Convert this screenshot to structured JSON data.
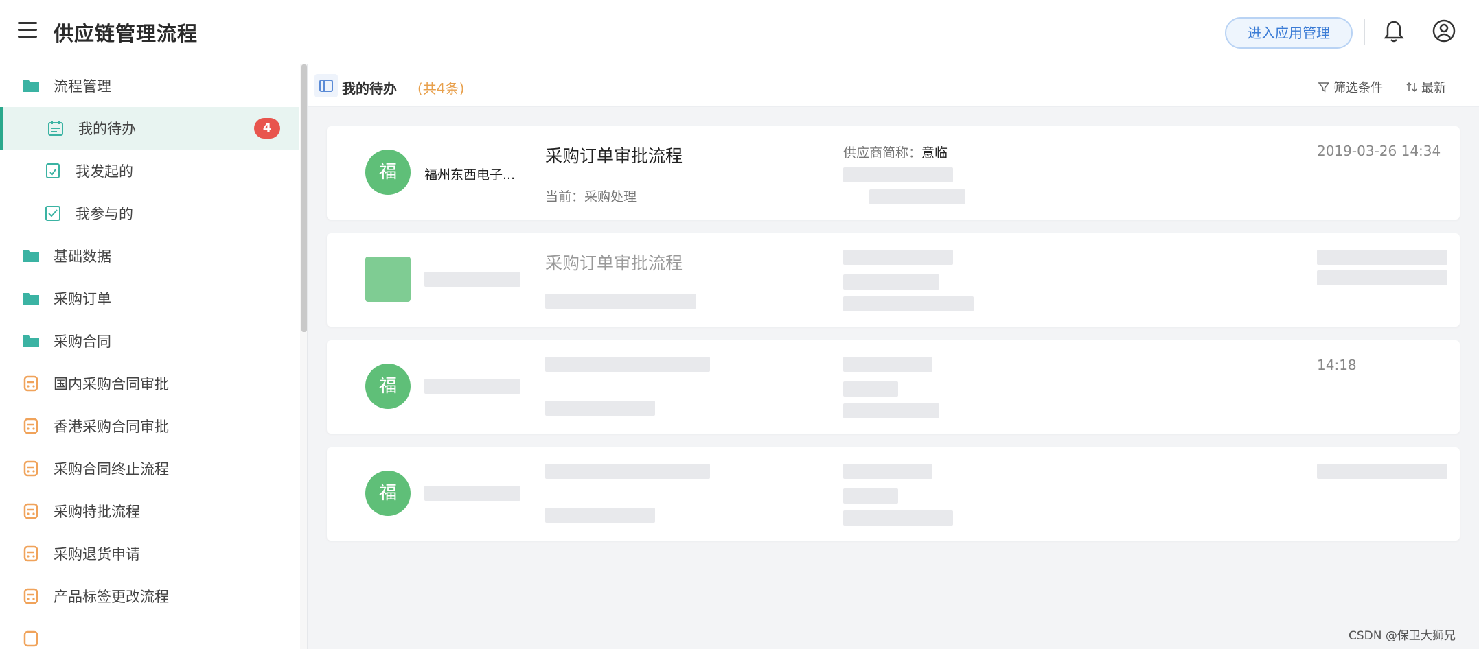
{
  "app": {
    "title": "供应链管理流程",
    "enter_button": "进入应用管理"
  },
  "sidebar": {
    "items": [
      {
        "label": "流程管理",
        "icon": "folder-icon",
        "level": 0
      },
      {
        "label": "我的待办",
        "icon": "calendar-todo-icon",
        "level": 1,
        "badge": "4",
        "active": true
      },
      {
        "label": "我发起的",
        "icon": "document-start-icon",
        "level": 1
      },
      {
        "label": "我参与的",
        "icon": "checkbox-icon",
        "level": 1
      },
      {
        "label": "基础数据",
        "icon": "folder-icon",
        "level": 0
      },
      {
        "label": "采购订单",
        "icon": "folder-icon",
        "level": 0
      },
      {
        "label": "采购合同",
        "icon": "folder-icon",
        "level": 0
      },
      {
        "label": "国内采购合同审批",
        "icon": "process-icon",
        "level": 0
      },
      {
        "label": "香港采购合同审批",
        "icon": "process-icon",
        "level": 0
      },
      {
        "label": "采购合同终止流程",
        "icon": "process-icon",
        "level": 0
      },
      {
        "label": "采购特批流程",
        "icon": "process-icon",
        "level": 0
      },
      {
        "label": "采购退货申请",
        "icon": "process-icon",
        "level": 0
      },
      {
        "label": "产品标签更改流程",
        "icon": "process-icon",
        "level": 0
      }
    ]
  },
  "main": {
    "title": "我的待办",
    "count": "(共4条)",
    "filter_label": "筛选条件",
    "sort_label": "最新",
    "cards": [
      {
        "avatar": "福",
        "company": "福州东西电子...",
        "title": "采购订单审批流程",
        "current": "当前：采购处理",
        "supplier_key": "供应商简称：",
        "supplier_val": "意临",
        "time": "2019-03-26 14:34"
      },
      {
        "avatar": "",
        "company": "",
        "title": "采购订单审批流程",
        "current": "",
        "supplier_key": "",
        "supplier_val": "",
        "time": ""
      },
      {
        "avatar": "福",
        "company": "",
        "title": "",
        "current": "",
        "supplier_key": "",
        "supplier_val": "",
        "time": "14:18"
      },
      {
        "avatar": "福",
        "company": "",
        "title": "",
        "current": "",
        "supplier_key": "",
        "supplier_val": "",
        "time": ""
      }
    ]
  },
  "watermark": "CSDN @保卫大狮兄",
  "colors": {
    "accent_green": "#2aa88c",
    "avatar_green": "#5fbf78",
    "badge_red": "#e8554e",
    "count_orange": "#e8a04c",
    "folder_teal": "#3bb3a3",
    "process_orange": "#f0a35b"
  }
}
